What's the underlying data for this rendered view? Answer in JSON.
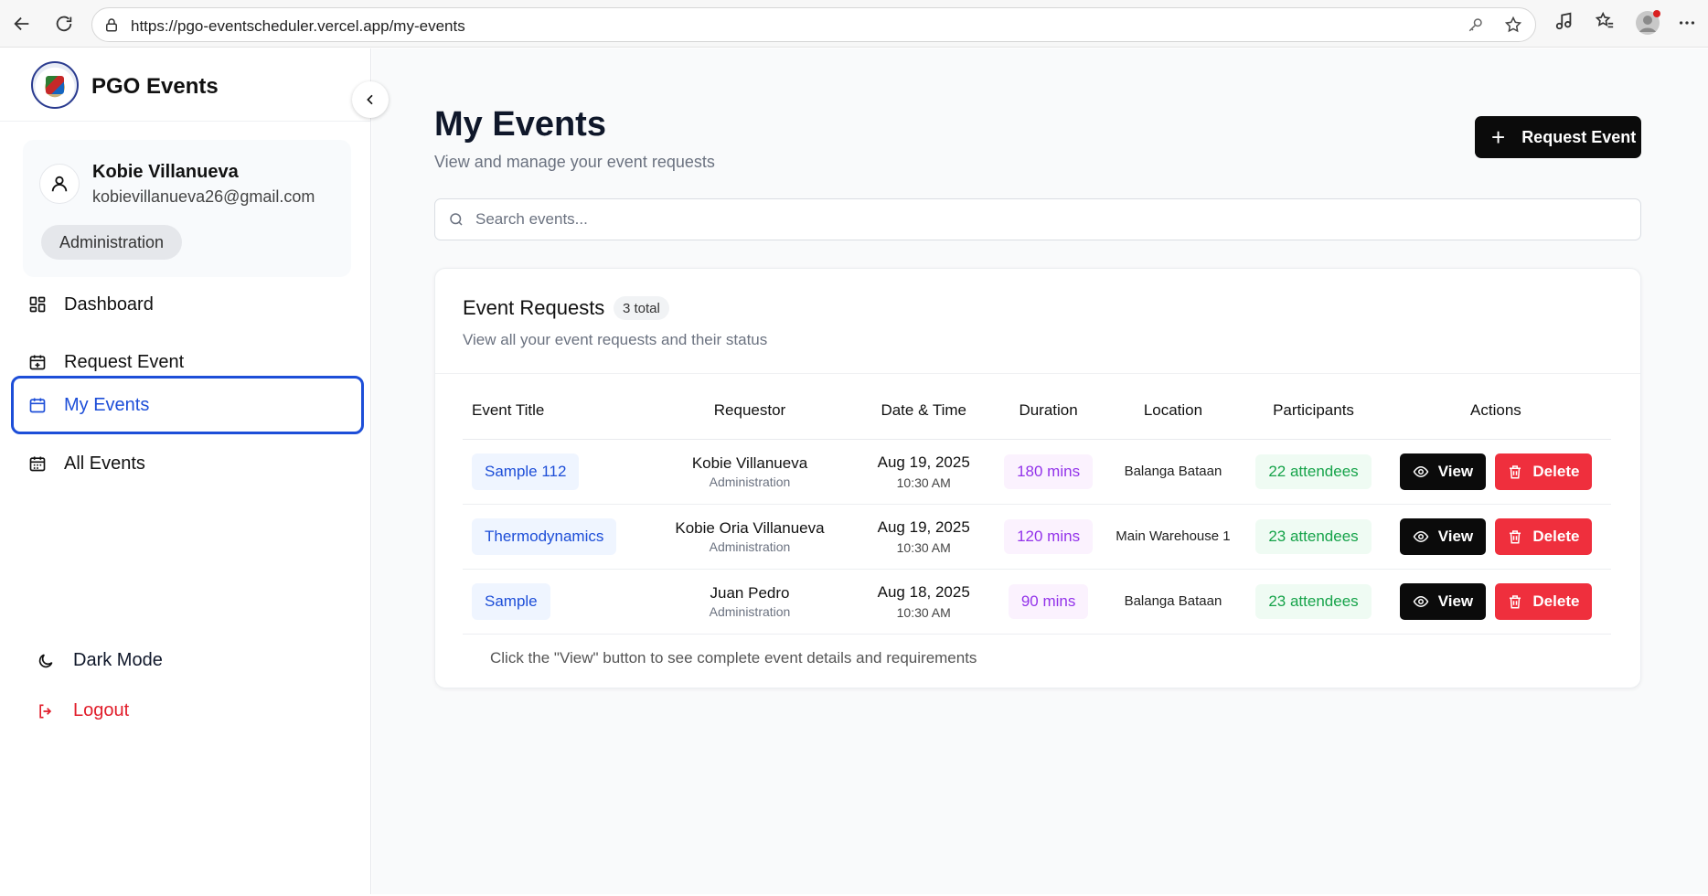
{
  "browser": {
    "url": "https://pgo-eventscheduler.vercel.app/my-events"
  },
  "sidebar": {
    "brand": "PGO Events",
    "user": {
      "name": "Kobie Villanueva",
      "email": "kobievillanueva26@gmail.com",
      "role": "Administration"
    },
    "nav": [
      {
        "label": "Dashboard",
        "icon": "dashboard-icon"
      },
      {
        "label": "Request Event",
        "icon": "calendar-plus-icon"
      },
      {
        "label": "My Events",
        "icon": "calendar-icon",
        "active": true
      },
      {
        "label": "All Events",
        "icon": "calendar-grid-icon"
      }
    ],
    "dark_mode_label": "Dark Mode",
    "logout_label": "Logout"
  },
  "main": {
    "title": "My Events",
    "subtitle": "View and manage your event requests",
    "request_button": "Request Event",
    "search": {
      "placeholder": "Search events...",
      "value": ""
    },
    "card": {
      "title": "Event Requests",
      "count": "3 total",
      "subtitle": "View all your event requests and their status",
      "columns": [
        "Event Title",
        "Requestor",
        "Date & Time",
        "Duration",
        "Location",
        "Participants",
        "Actions"
      ],
      "rows": [
        {
          "title": "Sample 112",
          "requestor": "Kobie Villanueva",
          "dept": "Administration",
          "date": "Aug 19, 2025",
          "time": "10:30 AM",
          "duration": "180 mins",
          "location": "Balanga Bataan",
          "participants": "22 attendees"
        },
        {
          "title": "Thermodynamics",
          "requestor": "Kobie Oria Villanueva",
          "dept": "Administration",
          "date": "Aug 19, 2025",
          "time": "10:30 AM",
          "duration": "120 mins",
          "location": "Main Warehouse 1",
          "participants": "23 attendees"
        },
        {
          "title": "Sample",
          "requestor": "Juan Pedro",
          "dept": "Administration",
          "date": "Aug 18, 2025",
          "time": "10:30 AM",
          "duration": "90 mins",
          "location": "Balanga Bataan",
          "participants": "23 attendees"
        }
      ],
      "view_label": "View",
      "delete_label": "Delete",
      "footnote": "Click the \"View\" button to see complete event details and requirements"
    }
  },
  "colors": {
    "accent": "#1d4ed8",
    "danger": "#ef2f3d",
    "duration": "#9333ea",
    "participants": "#16a34a"
  }
}
